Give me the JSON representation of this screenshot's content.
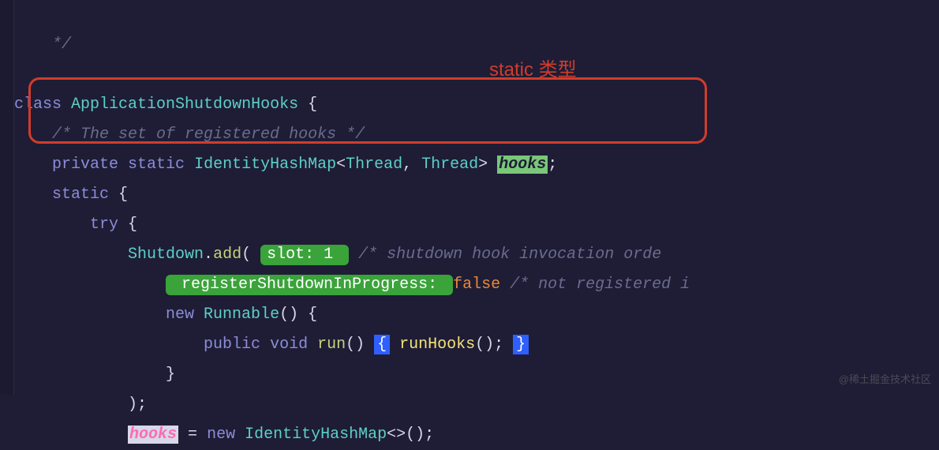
{
  "annotation": "static 类型",
  "watermark": "@稀土掘金技术社区",
  "code": {
    "l0_end_comment": "*/",
    "l1_kw_class": "class",
    "l1_name": "ApplicationShutdownHooks",
    "l1_brace": " {",
    "l2_comment": "/* The set of registered hooks */",
    "l3_private": "private",
    "l3_static": "static",
    "l3_type": "IdentityHashMap",
    "l3_generic_open": "<",
    "l3_thread1": "Thread",
    "l3_comma": ", ",
    "l3_thread2": "Thread",
    "l3_generic_close": "> ",
    "l3_hooks": "hooks",
    "l3_semi": ";",
    "l4_static": "static",
    "l4_brace": " {",
    "l5_try": "try",
    "l5_brace": " {",
    "l6_obj": "Shutdown",
    "l6_dot": ".",
    "l6_add": "add",
    "l6_paren": "( ",
    "l6_slot_label": "slot:",
    "l6_slot_val": " 1 ",
    "l6_comment": "/* shutdown hook invocation orde",
    "l7_reg_label": " registerShutdownInProgress: ",
    "l7_false": "false",
    "l7_comment": " /* not registered i",
    "l8_new": "new",
    "l8_runnable": " Runnable",
    "l8_tail": "() {",
    "l9_public": "public",
    "l9_void": " void",
    "l9_run": " run",
    "l9_paren": "() ",
    "l9_open": "{",
    "l9_call": " runHooks",
    "l9_call_end": "(); ",
    "l9_close": "}",
    "l10_close": "}",
    "l11_close": ");",
    "l12_hooks": "hooks",
    "l12_eq": " = ",
    "l12_new": "new",
    "l12_type": " IdentityHashMap",
    "l12_generic": "<>();"
  }
}
